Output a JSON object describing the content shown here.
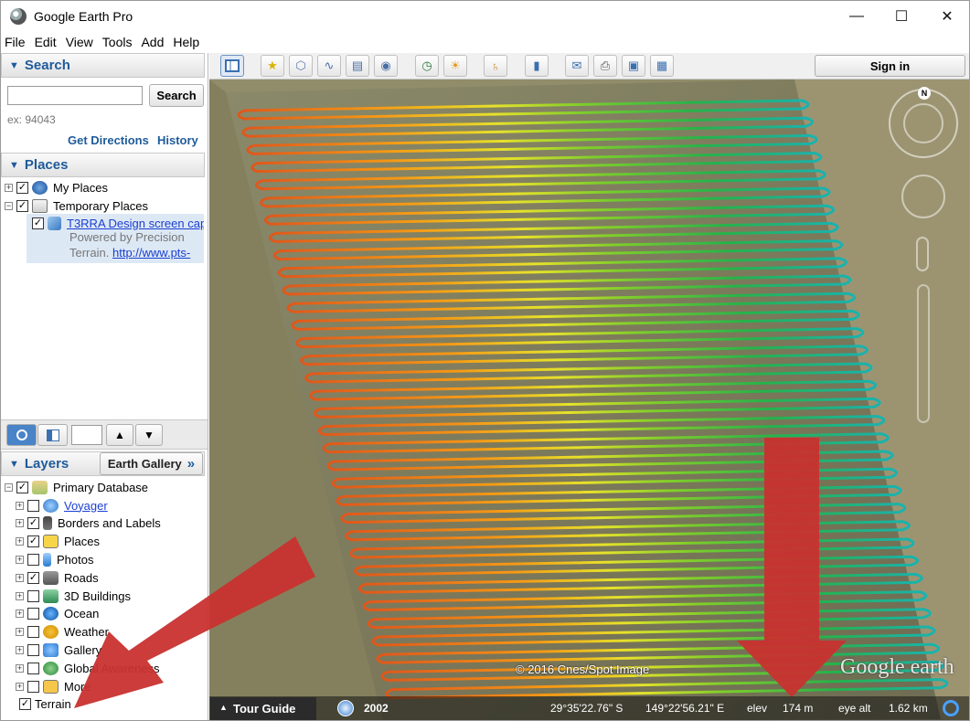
{
  "window": {
    "title": "Google Earth Pro",
    "minimize": "—",
    "maximize": "☐",
    "close": "✕"
  },
  "menu": [
    "File",
    "Edit",
    "View",
    "Tools",
    "Add",
    "Help"
  ],
  "search": {
    "header": "Search",
    "input_value": "",
    "button": "Search",
    "example": "ex: 94043",
    "get_directions": "Get Directions",
    "history": "History"
  },
  "places": {
    "header": "Places",
    "items": [
      {
        "label": "My Places",
        "checked": true
      },
      {
        "label": "Temporary Places",
        "checked": true
      }
    ],
    "selected_item": {
      "title": "T3RRA Design screen cap",
      "line1": "Powered by Precision",
      "line2": "Terrain.",
      "link": "http://www.pts-"
    }
  },
  "layers": {
    "header": "Layers",
    "gallery_button": "Earth Gallery",
    "gallery_arrow": "»",
    "root": {
      "label": "Primary Database",
      "checked": true
    },
    "items": [
      {
        "label": "Voyager",
        "checked": false,
        "link": true
      },
      {
        "label": "Borders and Labels",
        "checked": true
      },
      {
        "label": "Places",
        "checked": true
      },
      {
        "label": "Photos",
        "checked": false
      },
      {
        "label": "Roads",
        "checked": true
      },
      {
        "label": "3D Buildings",
        "checked": false
      },
      {
        "label": "Ocean",
        "checked": false
      },
      {
        "label": "Weather",
        "checked": false
      },
      {
        "label": "Gallery",
        "checked": false
      },
      {
        "label": "Global Awareness",
        "checked": false
      },
      {
        "label": "More",
        "checked": false
      },
      {
        "label": "Terrain",
        "checked": true
      }
    ]
  },
  "toolbar": {
    "sign_in": "Sign in"
  },
  "map": {
    "attribution": "© 2016 Cnes/Spot Image",
    "logo": "Google earth",
    "compass_north": "N"
  },
  "status": {
    "tour_guide": "Tour Guide",
    "year": "2002",
    "lat": "29°35'22.76\" S",
    "lon": "149°22'56.21\" E",
    "elev_label": "elev",
    "elev_value": "174 m",
    "eye_label": "eye alt",
    "eye_value": "1.62 km"
  },
  "colors": {
    "accent": "#1f5b9a",
    "arrow": "#c8312f"
  }
}
